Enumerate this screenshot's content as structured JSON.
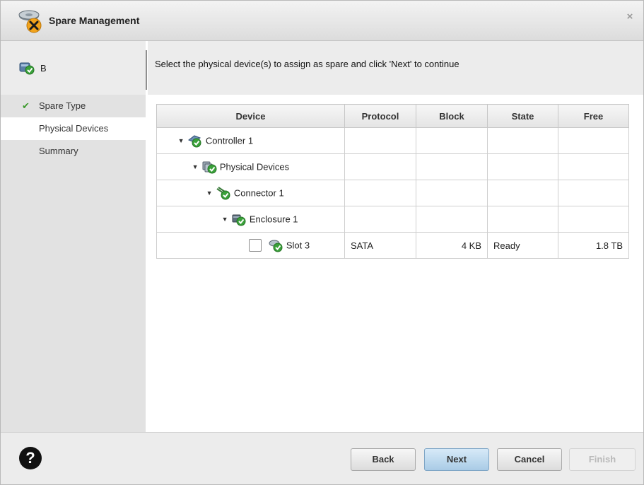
{
  "window": {
    "title": "Spare Management",
    "title_icon": "spare-drive-icon",
    "close_icon": "close-icon",
    "close_glyph": "×"
  },
  "header": {
    "controller_label": "B",
    "controller_icon": "controller-icon",
    "instruction": "Select the physical device(s) to assign as spare and click 'Next' to continue"
  },
  "sidebar": {
    "items": [
      {
        "label": "Spare Type",
        "state": "completed",
        "check_glyph": "✔"
      },
      {
        "label": "Physical Devices",
        "state": "active"
      },
      {
        "label": "Summary",
        "state": "pending"
      }
    ]
  },
  "table": {
    "columns": [
      "Device",
      "Protocol",
      "Block",
      "State",
      "Free"
    ],
    "rows": [
      {
        "label": "Controller 1",
        "icon": "controller-icon",
        "depth": 0,
        "expanded": true,
        "protocol": "",
        "block": "",
        "state": "",
        "free": ""
      },
      {
        "label": "Physical Devices",
        "icon": "physical-devices-icon",
        "depth": 1,
        "expanded": true,
        "protocol": "",
        "block": "",
        "state": "",
        "free": ""
      },
      {
        "label": "Connector 1",
        "icon": "connector-icon",
        "depth": 2,
        "expanded": true,
        "protocol": "",
        "block": "",
        "state": "",
        "free": ""
      },
      {
        "label": "Enclosure 1",
        "icon": "enclosure-icon",
        "depth": 3,
        "expanded": true,
        "protocol": "",
        "block": "",
        "state": "",
        "free": ""
      },
      {
        "label": "Slot 3",
        "icon": "disk-icon",
        "depth": 4,
        "checkbox": true,
        "checked": false,
        "protocol": "SATA",
        "block": "4 KB",
        "state": "Ready",
        "free": "1.8 TB"
      }
    ]
  },
  "footer": {
    "help_icon": "help-icon",
    "help_glyph": "?",
    "back_label": "Back",
    "next_label": "Next",
    "cancel_label": "Cancel",
    "finish_label": "Finish",
    "finish_enabled": false
  },
  "colors": {
    "status_ok": "#3aa13a",
    "primary_button": "#a9cbe6",
    "sidebar_bg": "#e2e2e2",
    "header_bg": "#ececec"
  }
}
